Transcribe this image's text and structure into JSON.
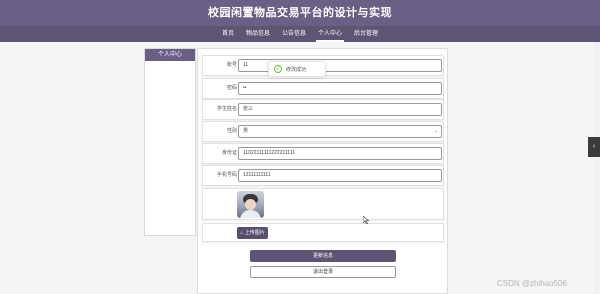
{
  "header": {
    "title": "校园闲置物品交易平台的设计与实现"
  },
  "nav": {
    "items": [
      {
        "label": "首页"
      },
      {
        "label": "物品信息"
      },
      {
        "label": "公告信息"
      },
      {
        "label": "个人中心"
      },
      {
        "label": "后台管理"
      }
    ],
    "active": "个人中心"
  },
  "sidebar": {
    "heading": "个人中心"
  },
  "form": {
    "fields": [
      {
        "label": "账号",
        "value": "11"
      },
      {
        "label": "密码",
        "value": "••"
      },
      {
        "label": "学生姓名",
        "value": "张三"
      },
      {
        "label": "性别",
        "value": "男"
      },
      {
        "label": "身份证",
        "value": "11022111111222211111"
      },
      {
        "label": "手机号码",
        "value": "13111111111"
      }
    ],
    "upload_label": "上传图片",
    "update_label": "更新信息",
    "logout_label": "退出登录"
  },
  "toast": {
    "message": "修改成功"
  },
  "watermark": "CSDN @zhihao506",
  "icons": {
    "side_tab": "chevron-left-icon",
    "toast": "check-circle-icon",
    "upload": "home-icon"
  },
  "colors": {
    "brand": "#6b5f86",
    "nav": "#5e5474",
    "success": "#67c23a"
  }
}
